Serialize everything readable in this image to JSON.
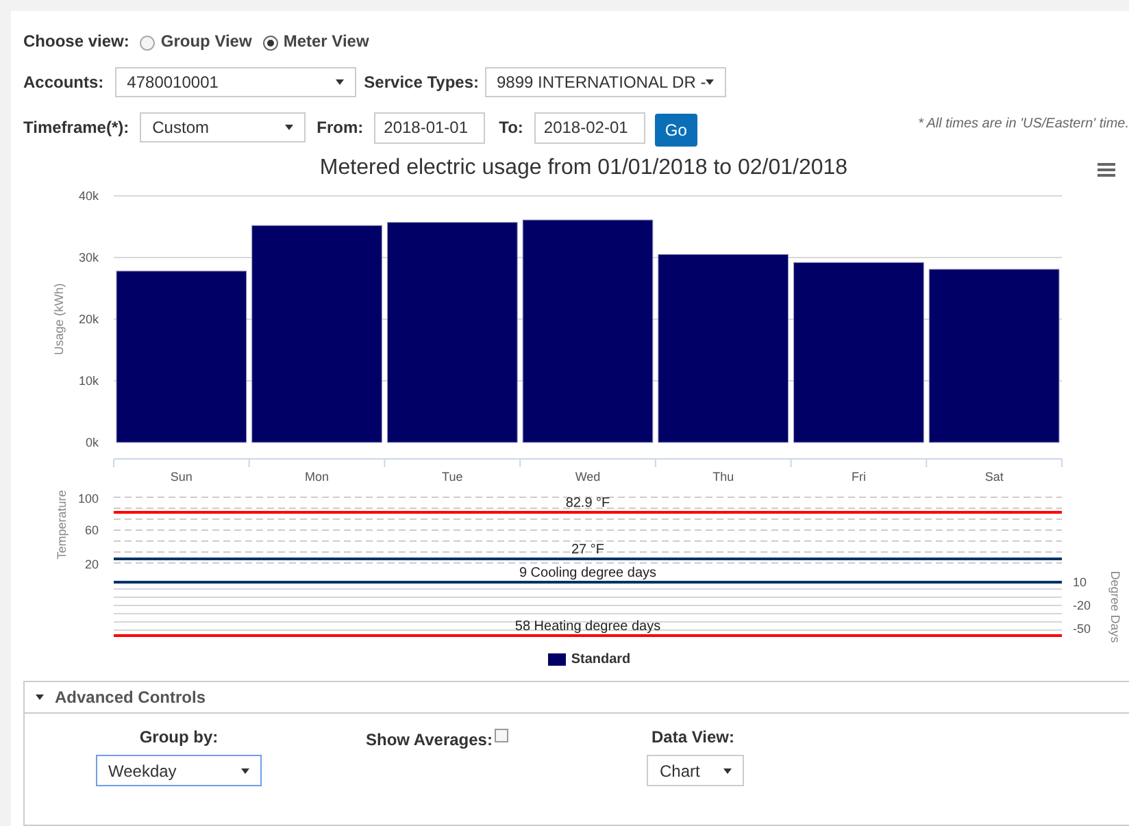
{
  "view_choice": {
    "label": "Choose view:",
    "options": [
      {
        "label": "Group View",
        "selected": false
      },
      {
        "label": "Meter View",
        "selected": true
      }
    ]
  },
  "accounts": {
    "label": "Accounts:",
    "value": "4780010001"
  },
  "service_types": {
    "label": "Service Types:",
    "value": "9899 INTERNATIONAL DR -"
  },
  "timeframe": {
    "label": "Timeframe(*):",
    "value": "Custom"
  },
  "from": {
    "label": "From:",
    "value": "2018-01-01"
  },
  "to": {
    "label": "To:",
    "value": "2018-02-01"
  },
  "go_button": "Go",
  "timezone_note": "* All times are in 'US/Eastern' time.",
  "usage_chart": {
    "chart_data": {
      "type": "bar",
      "title": "Metered electric usage from 01/01/2018 to 02/01/2018",
      "ylabel": "Usage (kWh)",
      "categories": [
        "Sun",
        "Mon",
        "Tue",
        "Wed",
        "Thu",
        "Fri",
        "Sat"
      ],
      "series": [
        {
          "name": "Standard",
          "color": "#000066",
          "values": [
            27800,
            35200,
            35700,
            36100,
            30500,
            29200,
            28100
          ]
        }
      ],
      "ylim": [
        0,
        40000
      ],
      "grid": true,
      "yticks": [
        {
          "value": 0,
          "label": "0k"
        },
        {
          "value": 10000,
          "label": "10k"
        },
        {
          "value": 20000,
          "label": "20k"
        },
        {
          "value": 30000,
          "label": "30k"
        },
        {
          "value": 40000,
          "label": "40k"
        }
      ]
    }
  },
  "weather_panel": {
    "left_axis": {
      "title": "Temperature",
      "ticks": [
        "100",
        "60",
        "20"
      ]
    },
    "right_axis": {
      "title": "Degree Days",
      "ticks": [
        "10",
        "-20",
        "-50"
      ]
    },
    "lines": [
      {
        "label": "82.9 °F",
        "color": "#ff0000"
      },
      {
        "label": "27 °F",
        "color": "#003366"
      },
      {
        "label": "9 Cooling degree days",
        "color": "#003366"
      },
      {
        "label": "58 Heating degree days",
        "color": "#ff0000"
      }
    ]
  },
  "advanced_controls": {
    "title": "Advanced Controls",
    "expanded": true,
    "group_by": {
      "label": "Group by:",
      "value": "Weekday"
    },
    "show_averages": {
      "label": "Show Averages:",
      "checked": false
    },
    "data_view": {
      "label": "Data View:",
      "value": "Chart"
    }
  }
}
